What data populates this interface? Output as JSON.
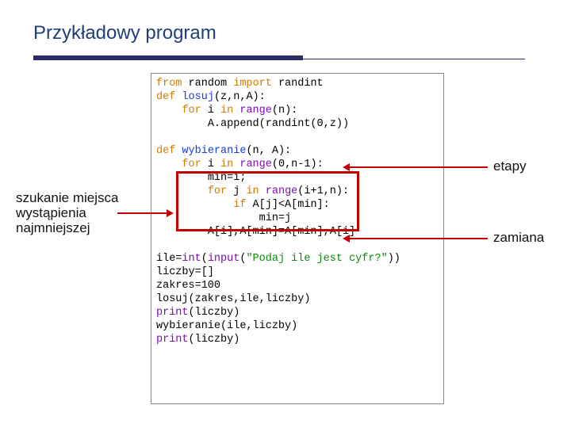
{
  "title": "Przykładowy program",
  "annotations": {
    "left": "szukanie miejsca wystąpienia najmniejszej",
    "right_top": "etapy",
    "right_bottom": "zamiana"
  },
  "code": {
    "l1_from": "from",
    "l1_rand": "random",
    "l1_imp": "import",
    "l1_rint": "randint",
    "l2_def": "def",
    "l2_name": "losuj",
    "l2_args": "(z,n,A):",
    "l3_for": "for",
    "l3_i": "i",
    "l3_in": "in",
    "l3_range": "range",
    "l3_rest": "(n):",
    "l4": "A.append(randint(0,z))",
    "l5_def": "def",
    "l5_name": "wybieranie",
    "l5_args": "(n, A):",
    "l6_for": "for",
    "l6_i": "i",
    "l6_in": "in",
    "l6_range": "range",
    "l6_rest": "(0,n-1):",
    "l7": "min=i;",
    "l8_for": "for",
    "l8_j": "j",
    "l8_in": "in",
    "l8_range": "range",
    "l8_rest": "(i+1,n):",
    "l9_if": "if",
    "l9_rest": "A[j]<A[min]:",
    "l10": "min=j",
    "l11": "A[i],A[min]=A[min],A[i]",
    "l12_a": "ile=",
    "l12_int": "int",
    "l12_b": "(",
    "l12_inp": "input",
    "l12_c": "(",
    "l12_str": "\"Podaj ile jest cyfr?\"",
    "l12_d": "))",
    "l13": "liczby=[]",
    "l14": "zakres=100",
    "l15": "losuj(zakres,ile,liczby)",
    "l16_print": "print",
    "l16_rest": "(liczby)",
    "l17": "wybieranie(ile,liczby)",
    "l18_print": "print",
    "l18_rest": "(liczby)"
  }
}
